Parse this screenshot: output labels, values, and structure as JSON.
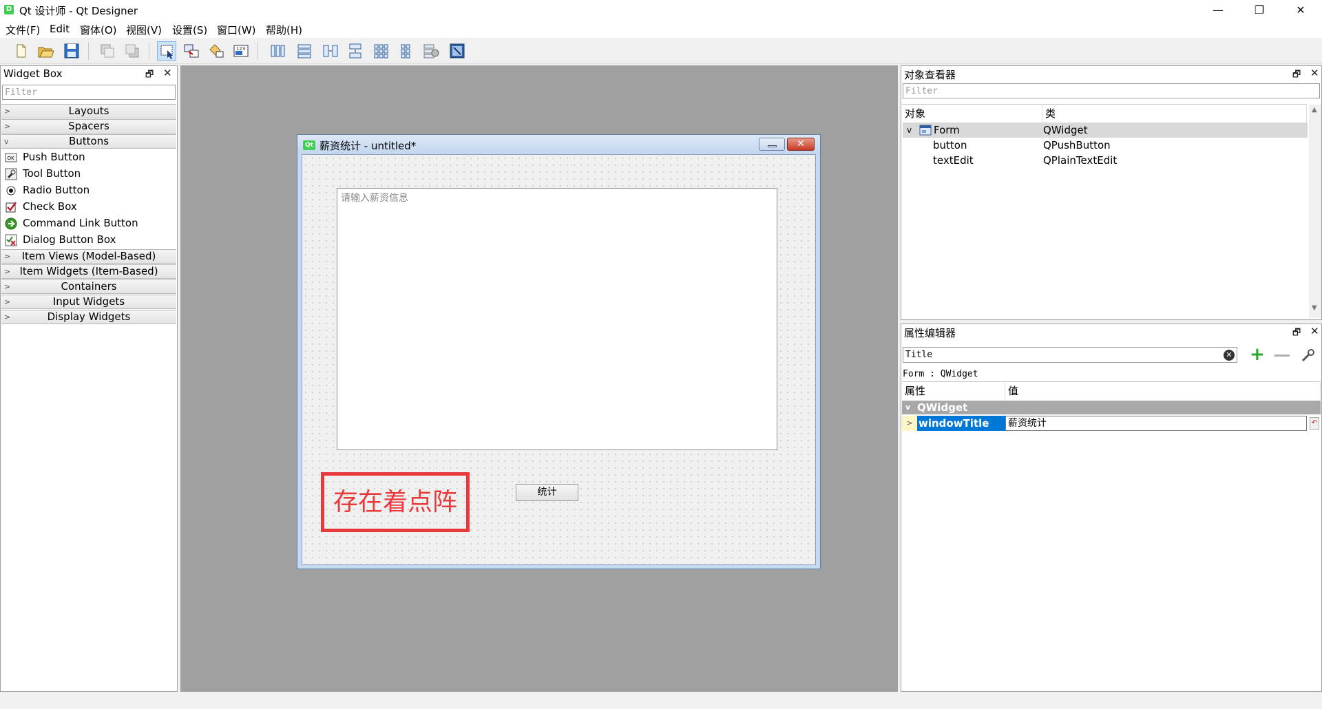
{
  "window": {
    "app_icon_text": "D",
    "title": "Qt 设计师 - Qt Designer",
    "controls": [
      "—",
      "❐",
      "✕"
    ]
  },
  "menu": [
    "文件(F)",
    "Edit",
    "窗体(O)",
    "视图(V)",
    "设置(S)",
    "窗口(W)",
    "帮助(H)"
  ],
  "toolbar": {
    "icons": [
      "new-file-icon",
      "open-folder-icon",
      "save-icon",
      "send-to-back-icon",
      "bring-to-front-icon",
      "edit-widgets-icon",
      "edit-signals-slots-icon",
      "edit-buddies-icon",
      "edit-tab-order-icon",
      "layout-horizontal-icon",
      "layout-vertical-icon",
      "layout-horizontal-splitter-icon",
      "layout-vertical-splitter-icon",
      "layout-grid-icon",
      "layout-form-icon",
      "break-layout-icon",
      "adjust-size-icon"
    ]
  },
  "widget_box": {
    "title": "Widget Box",
    "filter_placeholder": "Filter",
    "categories_top": [
      {
        "label": "Layouts",
        "expanded": false
      },
      {
        "label": "Spacers",
        "expanded": false
      },
      {
        "label": "Buttons",
        "expanded": true
      }
    ],
    "button_items": [
      {
        "label": "Push Button",
        "icon": "push-button-icon"
      },
      {
        "label": "Tool Button",
        "icon": "tool-button-icon"
      },
      {
        "label": "Radio Button",
        "icon": "radio-button-icon"
      },
      {
        "label": "Check Box",
        "icon": "check-box-icon"
      },
      {
        "label": "Command Link Button",
        "icon": "command-link-icon"
      },
      {
        "label": "Dialog Button Box",
        "icon": "dialog-button-box-icon"
      }
    ],
    "categories_bottom": [
      "Item Views (Model-Based)",
      "Item Widgets (Item-Based)",
      "Containers",
      "Input Widgets",
      "Display Widgets"
    ]
  },
  "form": {
    "icon_text": "Qt",
    "title": "薪资统计 - untitled*",
    "textedit_placeholder": "请输入薪资信息",
    "button_label": "统计"
  },
  "annotation": {
    "text": "存在着点阵",
    "color": "#e8393b"
  },
  "object_inspector": {
    "title": "对象查看器",
    "filter_placeholder": "Filter",
    "columns": [
      "对象",
      "类"
    ],
    "rows": [
      {
        "object": "Form",
        "class": "QWidget",
        "level": 0
      },
      {
        "object": "button",
        "class": "QPushButton",
        "level": 1
      },
      {
        "object": "textEdit",
        "class": "QPlainTextEdit",
        "level": 1
      }
    ]
  },
  "property_editor": {
    "title": "属性编辑器",
    "search_value": "Title",
    "context": "Form : QWidget",
    "columns": [
      "属性",
      "值"
    ],
    "group": "QWidget",
    "property_name": "windowTitle",
    "property_value": "薪资统计"
  },
  "colors": {
    "canvas": "#a0a0a0",
    "selection": "#0078d7",
    "group_header": "#a8a8a8"
  }
}
